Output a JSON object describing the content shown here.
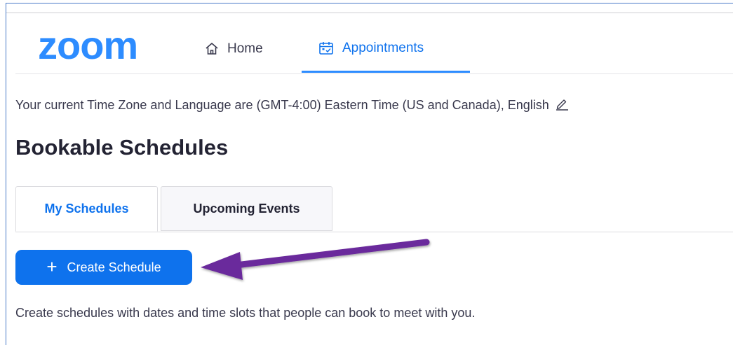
{
  "brand": {
    "logo_text": "zoom",
    "logo_color": "#2d8cff"
  },
  "nav": {
    "items": [
      {
        "label": "Home",
        "icon": "home-icon",
        "active": false
      },
      {
        "label": "Appointments",
        "icon": "calendar-icon",
        "active": true
      }
    ]
  },
  "settings": {
    "timezone_text": "Your current Time Zone and Language are (GMT-4:00) Eastern Time (US and Canada), English",
    "edit_icon": "pencil-icon"
  },
  "page": {
    "title": "Bookable Schedules"
  },
  "tabs": [
    {
      "label": "My Schedules",
      "active": true
    },
    {
      "label": "Upcoming Events",
      "active": false
    }
  ],
  "actions": {
    "create_label": "Create Schedule",
    "create_icon": "plus-icon",
    "button_color": "#0e72ed"
  },
  "annotation": {
    "arrow_color": "#6a2a9c",
    "arrow_icon": "arrow-left-icon"
  },
  "description": "Create schedules with dates and time slots that people can book to meet with you."
}
